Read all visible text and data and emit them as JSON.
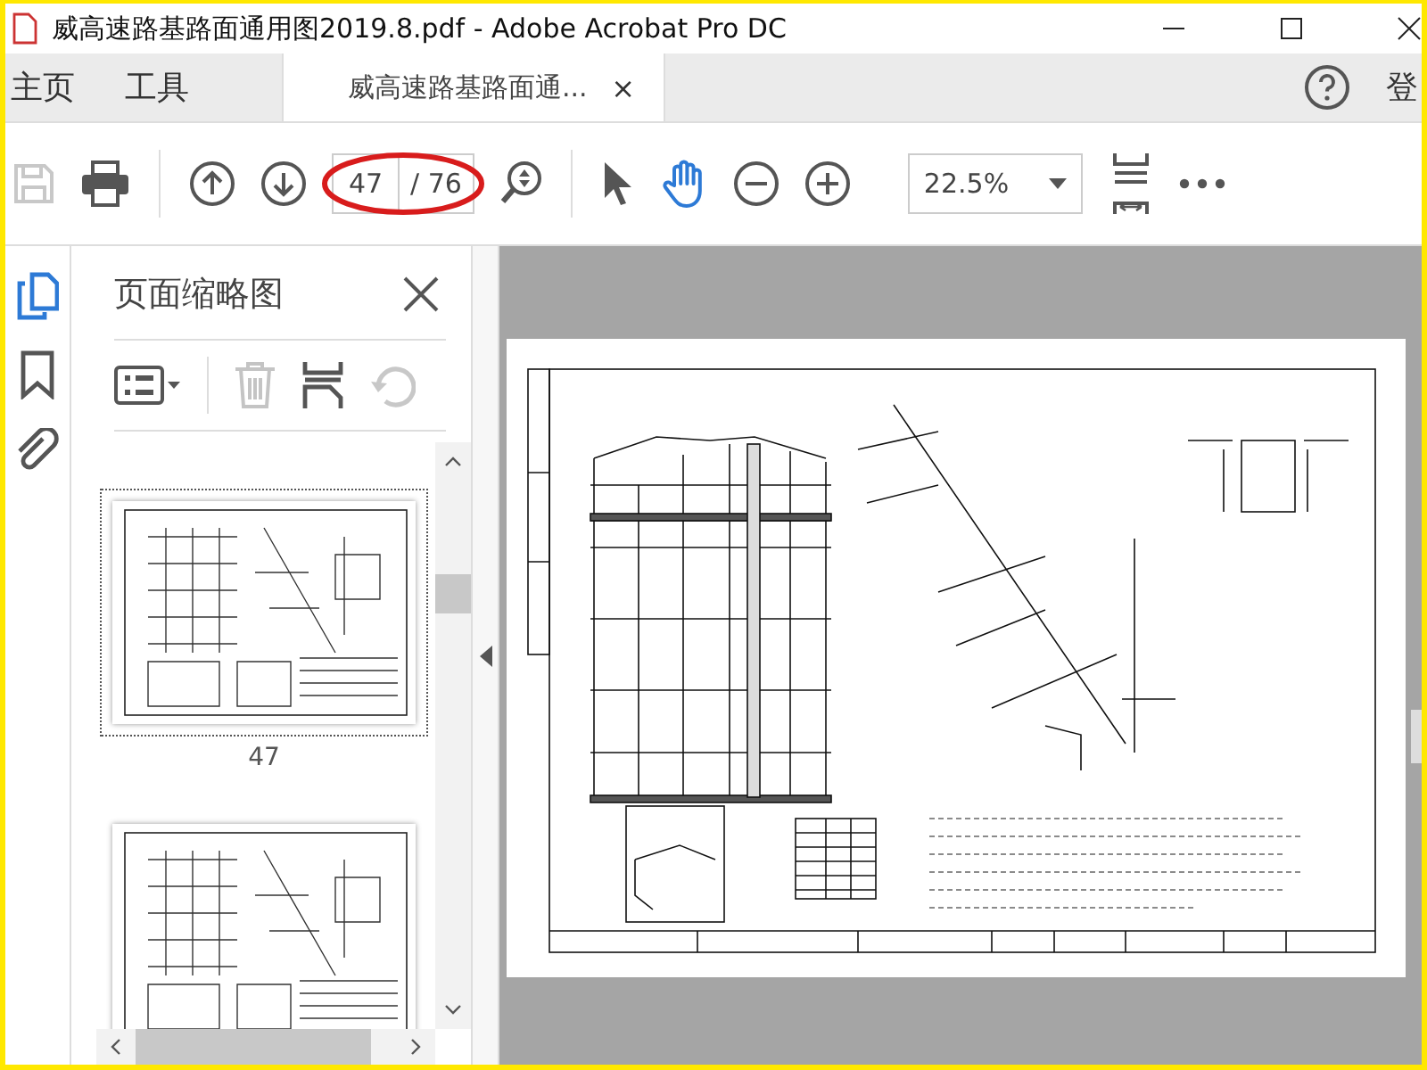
{
  "window": {
    "title": "威高速路基路面通用图2019.8.pdf - Adobe Acrobat Pro DC"
  },
  "nav_tabs": [
    {
      "label": "主页"
    },
    {
      "label": "工具"
    }
  ],
  "doc_tabs": [
    {
      "label": "威高速路基路面通...",
      "close": "×",
      "selected": true
    }
  ],
  "account": {
    "label": "登"
  },
  "toolbar": {
    "save_disabled": true,
    "page": {
      "value": "47",
      "total": "/ 76"
    },
    "zoom": {
      "value": "22.5%"
    },
    "tools": [
      {
        "kind": "select",
        "selected": false
      },
      {
        "kind": "hand",
        "selected": true
      }
    ]
  },
  "side_tools": [
    {
      "kind": "pages",
      "selected": true
    },
    {
      "kind": "bookmarks",
      "selected": false
    },
    {
      "kind": "attachments",
      "selected": false
    }
  ],
  "panel": {
    "title": "页面缩略图",
    "actions": [
      {
        "kind": "options",
        "disabled": false
      },
      {
        "kind": "delete",
        "disabled": true
      },
      {
        "kind": "extract",
        "disabled": false
      },
      {
        "kind": "rotate",
        "disabled": true
      }
    ],
    "thumbnails": [
      {
        "label": "47",
        "selected": true
      },
      {
        "selected": false
      }
    ]
  }
}
